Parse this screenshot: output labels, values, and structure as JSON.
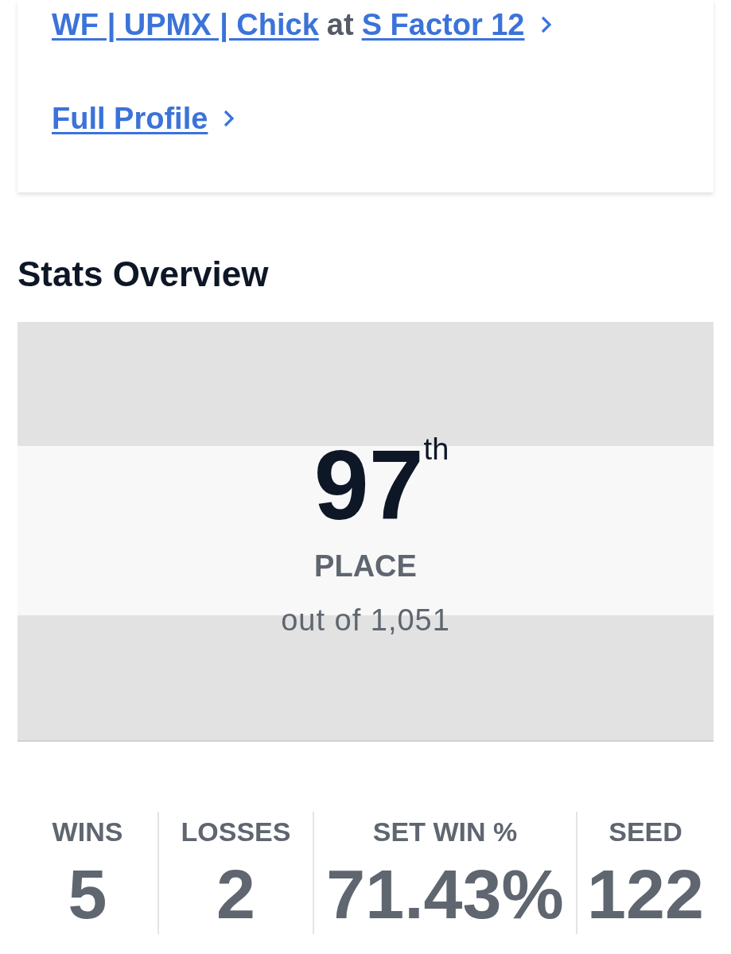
{
  "profile_links": [
    {
      "parts": [
        {
          "kind": "link",
          "text": "WF | UPMX | Chick"
        },
        {
          "kind": "text",
          "text": "at"
        },
        {
          "kind": "link",
          "text": "S Factor 12"
        }
      ]
    },
    {
      "parts": [
        {
          "kind": "link",
          "text": "Full Profile"
        }
      ]
    }
  ],
  "stats_overview": {
    "title": "Stats Overview",
    "rank": {
      "number": "97",
      "suffix": "th",
      "label": "PLACE",
      "subtext": "out of 1,051"
    },
    "metrics": [
      {
        "label": "WINS",
        "value": "5"
      },
      {
        "label": "LOSSES",
        "value": "2"
      },
      {
        "label": "SET WIN %",
        "value": "71.43%"
      },
      {
        "label": "SEED",
        "value": "122"
      }
    ]
  }
}
